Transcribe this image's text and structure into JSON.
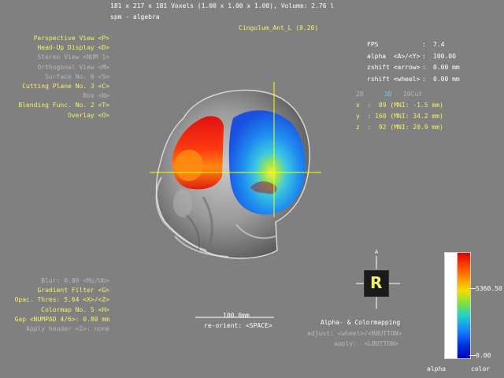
{
  "header": {
    "volume_info": "181 x 217 x 181 Voxels (1.00 x 1.00 x 1.00), Volume: 2.76 l",
    "dataset": "spm - algebra",
    "region": "Cingulum_Ant_L (8.20)"
  },
  "menu_top": [
    {
      "label": "Perspective View <P>",
      "enabled": true
    },
    {
      "label": "Head-Up Display <D>",
      "enabled": true
    },
    {
      "label": "Stereo View <NUM 1>",
      "enabled": false
    },
    {
      "label": "Orthogonal View <M>",
      "enabled": false
    },
    {
      "label": "Surface No. 0 <S>",
      "enabled": false
    },
    {
      "label": "Cutting Plane No. 3 <C>",
      "enabled": true
    },
    {
      "label": "Box <N>",
      "enabled": false
    },
    {
      "label": "Blending Func. No. 2 <T>",
      "enabled": true
    },
    {
      "label": "Overlay <O>",
      "enabled": true
    }
  ],
  "menu_bottom": [
    {
      "label": "Blur: 0.00 <Ms/Ub>",
      "enabled": false
    },
    {
      "label": "Gradient Filter <G>",
      "enabled": true
    },
    {
      "label": "Opac. Thres: 5.64 <X>/<Z>",
      "enabled": true
    },
    {
      "label": "Colormap No. 5 <H>",
      "enabled": true
    },
    {
      "label": "Gap <NUMPAD 4/6>: 0.80 mm",
      "enabled": true
    },
    {
      "label": "Apply header <I>: none",
      "enabled": false
    }
  ],
  "stats": [
    {
      "key": "FPS",
      "sep": ":",
      "value": "7.4"
    },
    {
      "key": "alpha  <A>/<Y>",
      "sep": ":",
      "value": "100.00"
    },
    {
      "key": "zshift <arrow>",
      "sep": ":",
      "value": "0.00 mm"
    },
    {
      "key": "rshift <wheel>",
      "sep": ":",
      "value": "0.00 mm"
    }
  ],
  "view_modes": {
    "m2d": "2D",
    "m3d": "3D",
    "m10cut": "10Cut"
  },
  "coords": [
    {
      "axis": "x",
      "vox": "89",
      "mni": "(MNI: -1.5 mm)"
    },
    {
      "axis": "y",
      "vox": "160",
      "mni": "(MNI: 34.2 mm)"
    },
    {
      "axis": "z",
      "vox": "92",
      "mni": "(MNI: 20.9 mm)"
    }
  ],
  "scale": {
    "length": "100.0mm",
    "reorient": "re-orient: <SPACE>"
  },
  "orientation_cube": {
    "letter": "R"
  },
  "colormapping": {
    "title": "Alpha- & Colormapping",
    "adjust": "adjust: <wheel>/<RBUTTON>",
    "apply": "apply:  <LBUTTON>"
  },
  "colorbar": {
    "max": "5360.50",
    "min": "0.00",
    "alpha_label": "alpha",
    "color_label": "color"
  },
  "colors": {
    "background": "#808080",
    "menu_active": "#f4f06a",
    "menu_inactive": "#b8b8b8",
    "crosshair": "#ffff00",
    "view_mode_active": "#6ec8ff"
  }
}
